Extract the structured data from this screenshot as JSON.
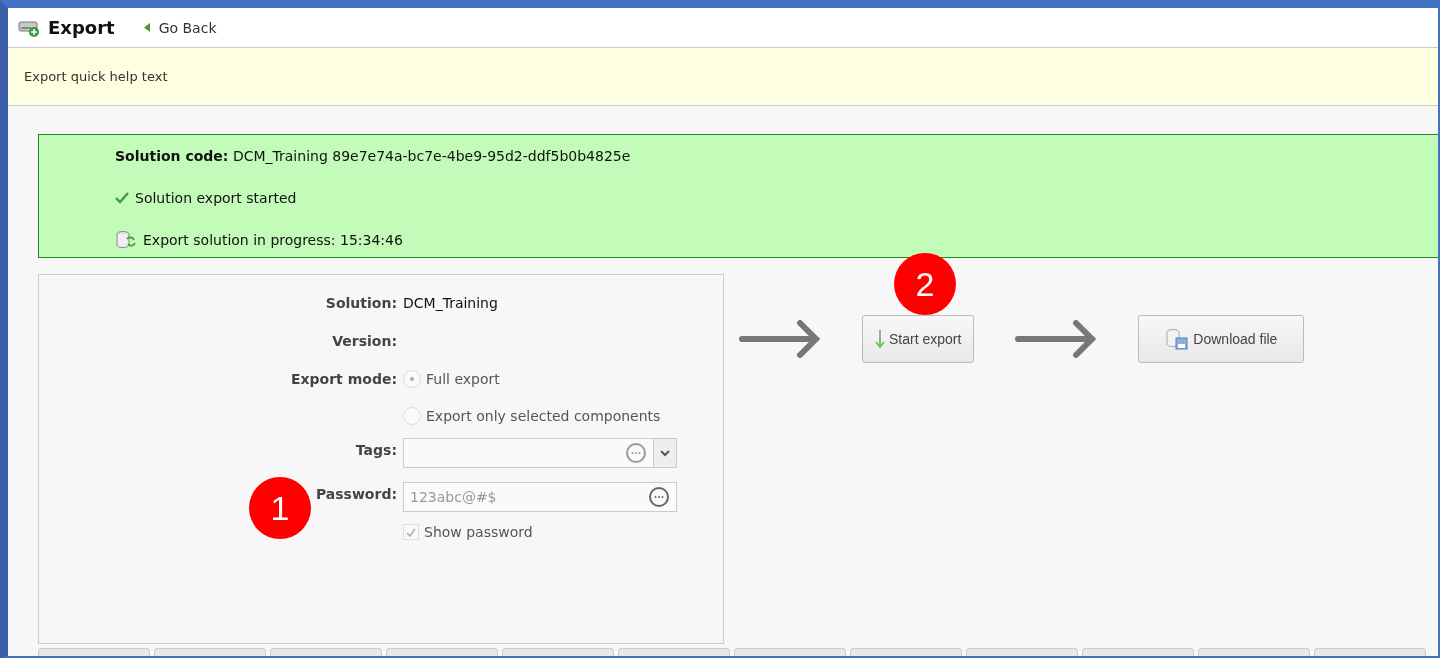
{
  "header": {
    "title": "Export",
    "back_link": "Go Back"
  },
  "help_text": "Export quick help text",
  "status": {
    "code_label": "Solution code:",
    "code_value": "DCM_Training 89e7e74a-bc7e-4be9-95d2-ddf5b0b4825e",
    "messages": [
      {
        "kind": "success",
        "text": "Solution export started"
      },
      {
        "kind": "progress",
        "text": "Export solution in progress: 15:34:46"
      }
    ]
  },
  "form": {
    "solution_label": "Solution:",
    "solution_value": "DCM_Training",
    "version_label": "Version:",
    "export_mode_label": "Export mode:",
    "export_modes": [
      {
        "label": "Full export",
        "selected": true
      },
      {
        "label": "Export only selected components",
        "selected": false
      }
    ],
    "tags_label": "Tags:",
    "password_label": "Password:",
    "password_value": "123abc@#$",
    "show_password": {
      "label": "Show password",
      "checked": true
    }
  },
  "steps": [
    {
      "label": "Start export",
      "kind": "start"
    },
    {
      "label": "Download file",
      "kind": "download"
    }
  ],
  "annotations": [
    "1",
    "2"
  ]
}
